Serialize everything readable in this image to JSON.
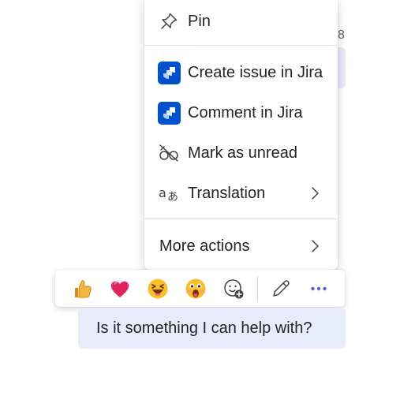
{
  "background": {
    "partial_timestamp_digit": "8"
  },
  "context_menu": {
    "items": [
      {
        "label": "Pin",
        "icon": "pin-icon"
      },
      {
        "label": "Create issue in Jira",
        "icon": "jira-icon"
      },
      {
        "label": "Comment in Jira",
        "icon": "jira-icon"
      },
      {
        "label": "Mark as unread",
        "icon": "eye-off-icon"
      },
      {
        "label": "Translation",
        "icon": "translate-icon",
        "has_submenu": true
      },
      {
        "label": "More actions",
        "has_submenu": true
      }
    ]
  },
  "reaction_bar": {
    "reactions": [
      "like-emoji",
      "heart-emoji",
      "laugh-emoji",
      "surprised-emoji"
    ],
    "actions": [
      "add-reaction-icon",
      "edit-icon",
      "more-icon"
    ]
  },
  "message": {
    "text": "Is it something I can help with?"
  },
  "colors": {
    "jira_blue": "#0052cc",
    "accent": "#5b5fc7",
    "bubble": "#e8ebfa"
  }
}
